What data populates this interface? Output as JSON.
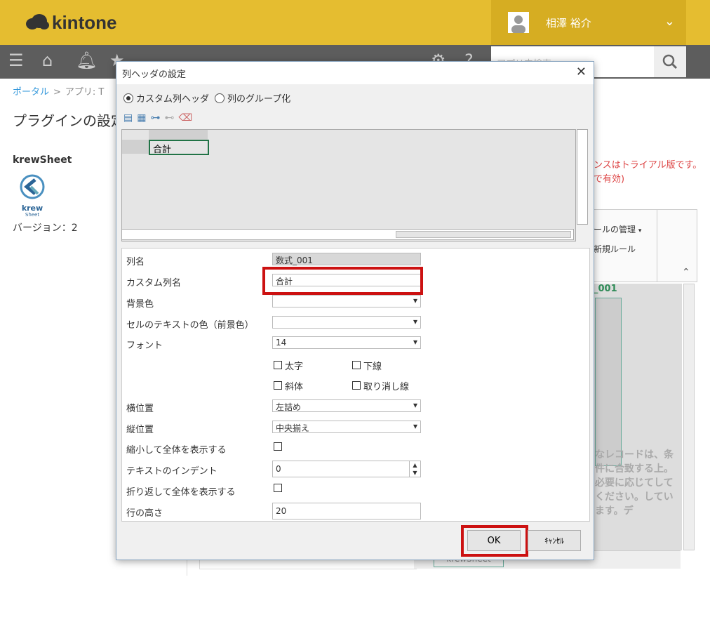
{
  "app": {
    "logo": "kintone",
    "user_name": "相澤 裕介",
    "search_placeholder": "アプリ内検索"
  },
  "breadcrumb": {
    "portal": "ポータル",
    "app": "アプリ: T"
  },
  "page": {
    "title": "プラグインの設定"
  },
  "plugin": {
    "name": "krewSheet",
    "logo_text": "krew",
    "logo_sub": "Sheet",
    "version": "バージョン：2"
  },
  "background": {
    "trial_line1": "ンスはトライアル版です。",
    "trial_line2": "で有効)",
    "rule_manage": "ールの管理",
    "new_rule": "新規ルール",
    "column_header": "_001",
    "notice": "なレコードは、条件に合致する上。必要に応じてしてください。しています。デ",
    "sheet_tab": "krewSheet"
  },
  "dialog": {
    "title": "列ヘッダの設定",
    "mode_custom": "カスタム列ヘッダ",
    "mode_group": "列のグループ化",
    "preview_cell": "合計",
    "fields": {
      "column_name_label": "列名",
      "column_name_value": "数式_001",
      "custom_name_label": "カスタム列名",
      "custom_name_value": "合計",
      "bg_color_label": "背景色",
      "fg_color_label": "セルのテキストの色（前景色）",
      "font_label": "フォント",
      "font_value": "14",
      "bold": "太字",
      "underline": "下線",
      "italic": "斜体",
      "strike": "取り消し線",
      "halign_label": "横位置",
      "halign_value": "左詰め",
      "valign_label": "縦位置",
      "valign_value": "中央揃え",
      "shrink_label": "縮小して全体を表示する",
      "indent_label": "テキストのインデント",
      "indent_value": "0",
      "wrap_label": "折り返して全体を表示する",
      "row_height_label": "行の高さ",
      "row_height_value": "20"
    },
    "ok": "OK",
    "cancel": "ｷｬﾝｾﾙ"
  },
  "colors": {
    "header": "#e5bd30",
    "navbar": "#5d5d5d",
    "highlight": "#cc1111"
  }
}
